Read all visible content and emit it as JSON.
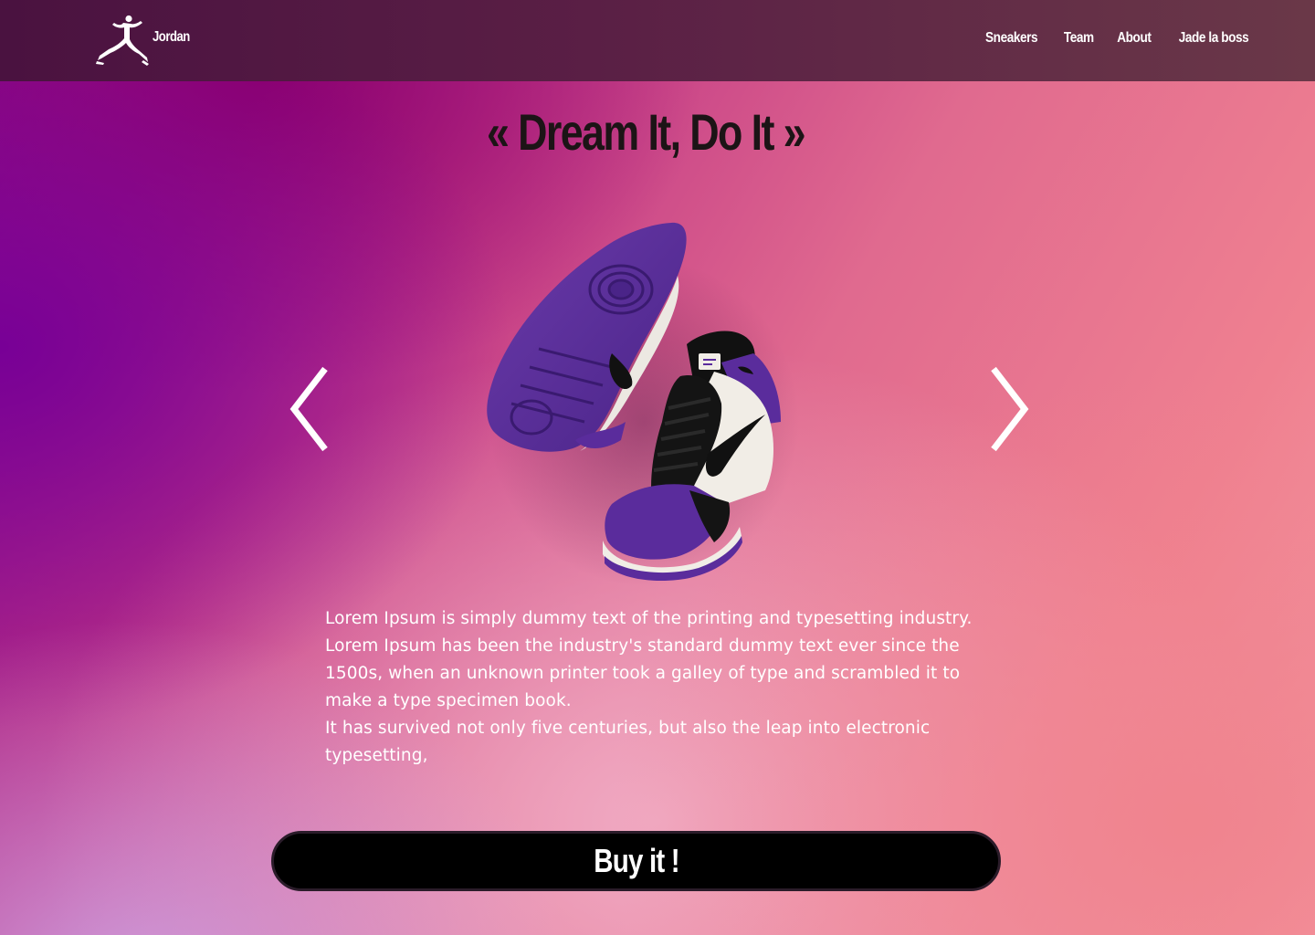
{
  "header": {
    "brand_name": "Jordan",
    "brand_icon": "jumpman-logo-icon",
    "nav": [
      {
        "label": "Sneakers"
      },
      {
        "label": "Team"
      },
      {
        "label": "About"
      },
      {
        "label": "Jade la boss"
      }
    ]
  },
  "hero": {
    "title": "« Dream It, Do It »",
    "prev_icon": "chevron-left-icon",
    "next_icon": "chevron-right-icon",
    "product_image": "sneaker-pair-image",
    "description_lines": [
      "Lorem Ipsum is simply dummy text of the printing and typesetting industry. Lorem Ipsum has been the industry's standard dummy text ever since the 1500s, when an unknown printer took a galley of type and scrambled it to make a type specimen book.",
      "It has survived not only five centuries, but also the leap into electronic typesetting,"
    ],
    "buy_label": "Buy it !"
  },
  "colors": {
    "header_bg": "#4a1240",
    "title_text": "#1c1416",
    "button_bg": "#000000",
    "shoe_purple": "#5a2c9c"
  }
}
